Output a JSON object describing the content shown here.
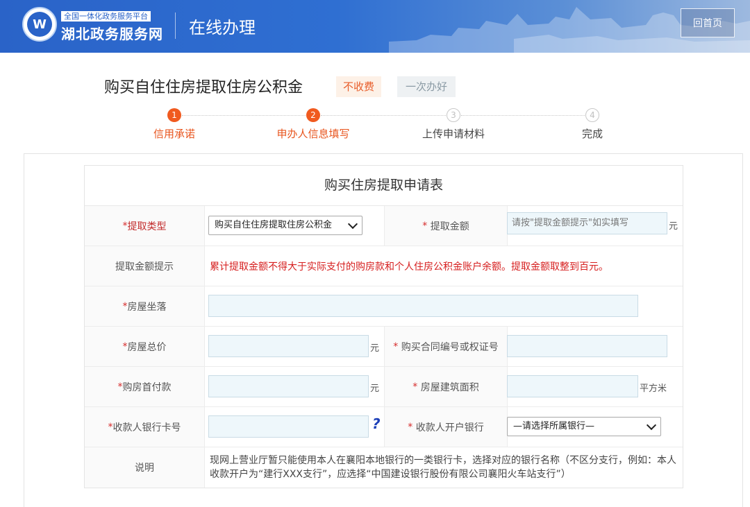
{
  "header": {
    "logo_char": "W",
    "brand_top": "全国一体化政务服务平台",
    "brand_main": "湖北政务服务网",
    "title": "在线办理",
    "home_label": "回首页"
  },
  "page": {
    "title": "购买自住住房提取住房公积金",
    "tags": [
      "不收费",
      "一次办好"
    ]
  },
  "steps": [
    {
      "num": "1",
      "label": "信用承诺",
      "state": "active"
    },
    {
      "num": "2",
      "label": "申办人信息填写",
      "state": "active"
    },
    {
      "num": "3",
      "label": "上传申请材料",
      "state": "pending"
    },
    {
      "num": "4",
      "label": "完成",
      "state": "pending"
    }
  ],
  "form": {
    "title": "购买住房提取申请表",
    "withdraw_type": {
      "label": "提取类型",
      "value": "购买自住住房提取住房公积金"
    },
    "withdraw_amount": {
      "label": "提取金额",
      "placeholder": "请按\"提取金额提示\"如实填写",
      "unit": "元"
    },
    "amount_hint": {
      "label": "提取金额提示",
      "text": "累计提取金额不得大于实际支付的购房款和个人住房公积金账户余额。提取金额取整到百元。"
    },
    "house_location": {
      "label": "房屋坐落"
    },
    "house_total_price": {
      "label": "房屋总价",
      "unit": "元"
    },
    "contract_no": {
      "label": "购买合同编号或权证号"
    },
    "down_payment": {
      "label": "购房首付款",
      "unit": "元"
    },
    "building_area": {
      "label": "房屋建筑面积",
      "unit": "平方米"
    },
    "payee_card": {
      "label": "收款人银行卡号",
      "help": "?"
    },
    "payee_bank": {
      "label": "收款人开户银行",
      "value": "—请选择所属银行—"
    },
    "note": {
      "label": "说明",
      "text": "现网上营业厅暂只能使用本人在襄阳本地银行的一类银行卡，选择对应的银行名称（不区分支行，例如：本人收款开户为“建行XXX支行”，应选择“中国建设银行股份有限公司襄阳火车站支行”）"
    }
  },
  "colors": {
    "header_blue": "#2a63c8",
    "accent_orange": "#f05a1f",
    "required_red": "#d62b2b",
    "field_bg": "#eef7fb"
  }
}
